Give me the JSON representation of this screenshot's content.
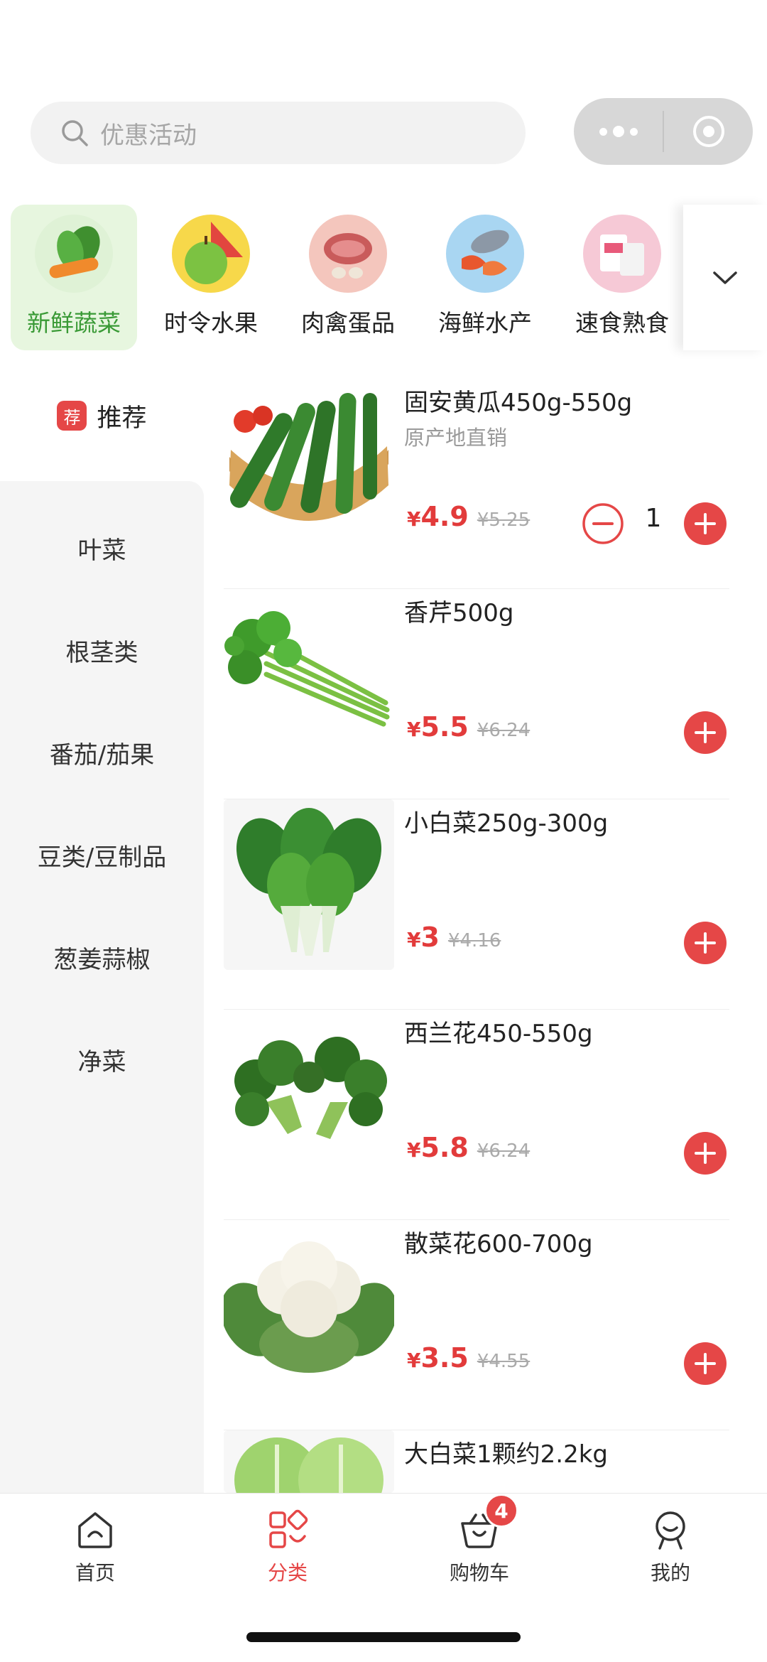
{
  "search": {
    "placeholder": "优惠活动"
  },
  "categories": [
    {
      "label": "新鲜蔬菜",
      "active": true
    },
    {
      "label": "时令水果",
      "active": false
    },
    {
      "label": "肉禽蛋品",
      "active": false
    },
    {
      "label": "海鲜水产",
      "active": false
    },
    {
      "label": "速食熟食",
      "active": false
    }
  ],
  "sidebar": {
    "recommend_tag": "荐",
    "recommend_label": "推荐",
    "items": [
      "叶菜",
      "根茎类",
      "番茄/茄果",
      "豆类/豆制品",
      "葱姜蒜椒",
      "净菜"
    ]
  },
  "products": [
    {
      "name": "固安黄瓜450g-550g",
      "subtitle": "原产地直销",
      "currency": "¥",
      "price": "4.9",
      "old_price": "¥5.25",
      "quantity": "1"
    },
    {
      "name": "香芹500g",
      "subtitle": "",
      "currency": "¥",
      "price": "5.5",
      "old_price": "¥6.24"
    },
    {
      "name": "小白菜250g-300g",
      "subtitle": "",
      "currency": "¥",
      "price": "3",
      "old_price": "¥4.16"
    },
    {
      "name": "西兰花450-550g",
      "subtitle": "",
      "currency": "¥",
      "price": "5.8",
      "old_price": "¥6.24"
    },
    {
      "name": "散菜花600-700g",
      "subtitle": "",
      "currency": "¥",
      "price": "3.5",
      "old_price": "¥4.55"
    },
    {
      "name": "大白菜1颗约2.2kg",
      "subtitle": ""
    }
  ],
  "tabbar": {
    "items": [
      {
        "label": "首页",
        "icon": "home-icon"
      },
      {
        "label": "分类",
        "icon": "category-icon"
      },
      {
        "label": "购物车",
        "icon": "cart-icon"
      },
      {
        "label": "我的",
        "icon": "profile-icon"
      }
    ],
    "cart_badge": "4",
    "active_index": 1
  },
  "colors": {
    "accent": "#e54747",
    "price": "#e23b3b",
    "category_active": "#3a9a36",
    "category_active_bg": "#e7f6df"
  }
}
